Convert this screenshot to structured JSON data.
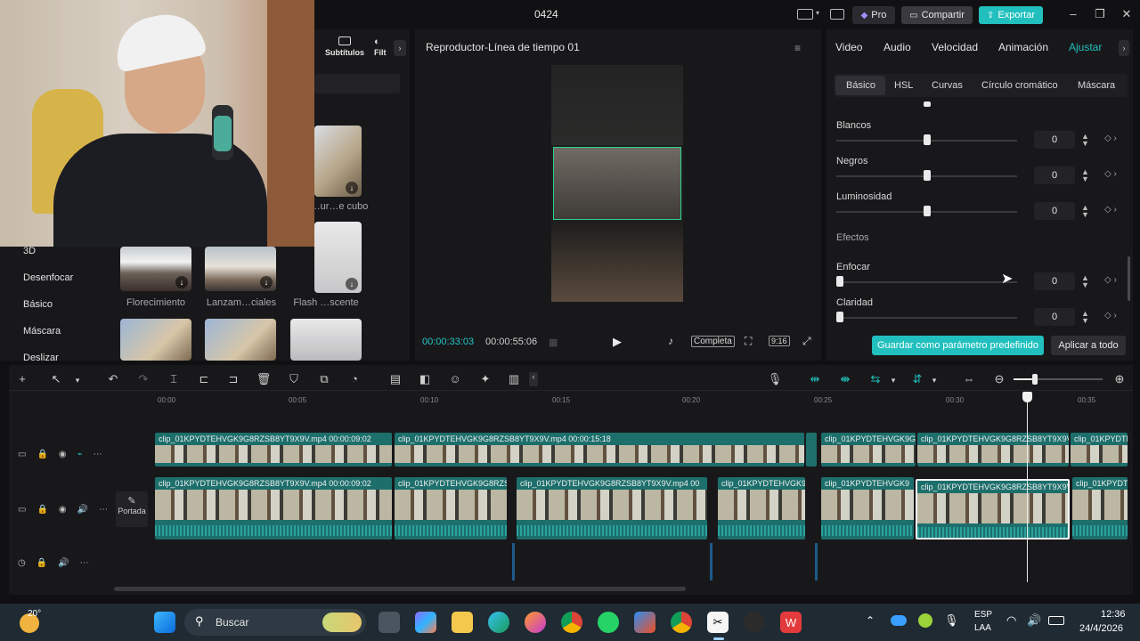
{
  "window": {
    "title": "0424",
    "pro_label": "Pro",
    "share_label": "Compartir",
    "export_label": "Exportar"
  },
  "media_panel": {
    "tabs": [
      {
        "label": "Subtítulos"
      },
      {
        "label": "Filt"
      }
    ],
    "categories": [
      "3D",
      "Desenfocar",
      "Básico",
      "Máscara",
      "Deslizar"
    ],
    "thumbnails": [
      {
        "label": "…ur…e cubo"
      },
      {
        "label": "Florecimiento"
      },
      {
        "label": "Lanzam…ciales"
      },
      {
        "label": "Flash …scente"
      }
    ]
  },
  "player": {
    "title": "Reproductor-Línea de tiempo 01",
    "current_time": "00:00:33:03",
    "total_time": "00:00:55:06",
    "quality_label": "Completa",
    "ratio_label": "9:16"
  },
  "inspector": {
    "tabs": [
      "Video",
      "Audio",
      "Velocidad",
      "Animación",
      "Ajustar"
    ],
    "active_tab": "Ajustar",
    "sub_tabs": [
      "Básico",
      "HSL",
      "Curvas",
      "Círculo cromático",
      "Máscara"
    ],
    "active_sub_tab": "Básico",
    "params": [
      {
        "name": "Blancos",
        "value": "0",
        "level": 0.5
      },
      {
        "name": "Negros",
        "value": "0",
        "level": 0.5
      },
      {
        "name": "Luminosidad",
        "value": "0",
        "level": 0.5
      }
    ],
    "effects_header": "Efectos",
    "effects": [
      {
        "name": "Enfocar",
        "value": "0",
        "level": 0
      },
      {
        "name": "Claridad",
        "value": "0",
        "level": 0
      }
    ],
    "save_preset_label": "Guardar como parámetro predefinido",
    "apply_all_label": "Aplicar a todo"
  },
  "timeline": {
    "ruler": [
      "00:00",
      "00:05",
      "00:10",
      "00:15",
      "00:20",
      "00:25",
      "00:30",
      "00:35"
    ],
    "cover_label": "Portada",
    "video_track_1": [
      {
        "label": "clip_01KPYDTEHVGK9G8RZSB8YT9X9V.mp4   00:00:09:02"
      },
      {
        "label": "clip_01KPYDTEHVGK9G8RZSB8YT9X9V.mp4   00:00:15:18"
      },
      {
        "label": "clip_01KPYDTEHVGK9G"
      },
      {
        "label": "clip_01KPYDTEHVGK9G8RZSB8YT9X9V"
      },
      {
        "label": "clip_01KPYDTE"
      }
    ],
    "video_track_2": [
      {
        "label": "clip_01KPYDTEHVGK9G8RZSB8YT9X9V.mp4   00:00:09:02"
      },
      {
        "label": "clip_01KPYDTEHVGK9G8RZS"
      },
      {
        "label": "clip_01KPYDTEHVGK9G8RZSB8YT9X9V.mp4   00"
      },
      {
        "label": "clip_01KPYDTEHVGK9"
      },
      {
        "label": "clip_01KPYDTEHVGK9"
      },
      {
        "label": "clip_01KPYDTEHVGK9G8RZSB8YT9X9V"
      },
      {
        "label": "clip_01KPYDTE"
      }
    ]
  },
  "taskbar": {
    "weather": "20°",
    "search_placeholder": "Buscar",
    "language": "ESP",
    "layout": "LAA",
    "time": "12:36",
    "date": "24/4/2026"
  },
  "colors": {
    "accent": "#21c0be",
    "clip": "#1d6f6c",
    "panel": "#18181b"
  }
}
